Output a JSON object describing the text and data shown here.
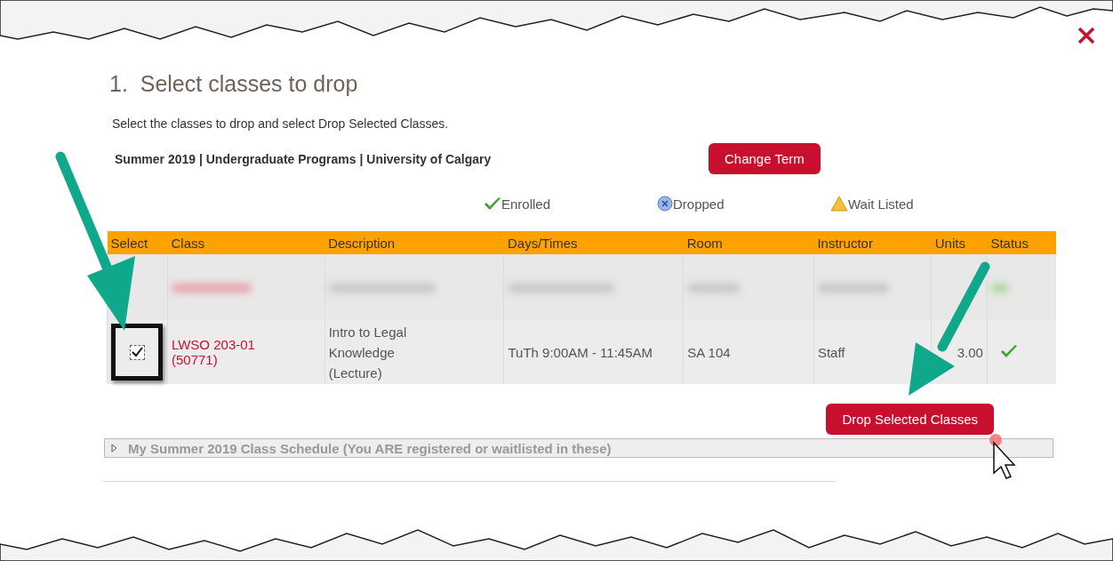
{
  "heading": "1.  Select classes to drop",
  "instructions": "Select the classes to drop and select Drop Selected Classes.",
  "term": "Summer 2019 | Undergraduate Programs | University of Calgary",
  "change_term_button": "Change Term",
  "legend": [
    {
      "kind": "enrolled",
      "label": "Enrolled"
    },
    {
      "kind": "dropped",
      "label": "Dropped"
    },
    {
      "kind": "waitlisted",
      "label": "Wait Listed"
    }
  ],
  "table": {
    "columns": [
      "Select",
      "Class",
      "Description",
      "Days/Times",
      "Room",
      "Instructor",
      "Units",
      "Status"
    ],
    "rows": [
      {
        "kind": "blurred"
      },
      {
        "kind": "class",
        "checked": true,
        "class": "LWSO 203-01\n(50771)",
        "description": "Intro to Legal\nKnowledge\n(Lecture)",
        "days_times": "TuTh 9:00AM - 11:45AM",
        "room": "SA 104",
        "instructor": "Staff",
        "units": "3.00",
        "status": {
          "kind": "enrolled"
        }
      }
    ]
  },
  "drop_button": "Drop Selected Classes",
  "schedule_section": {
    "title": "My Summer 2019 Class Schedule (You ARE registered or waitlisted in these)",
    "expanded": false
  }
}
